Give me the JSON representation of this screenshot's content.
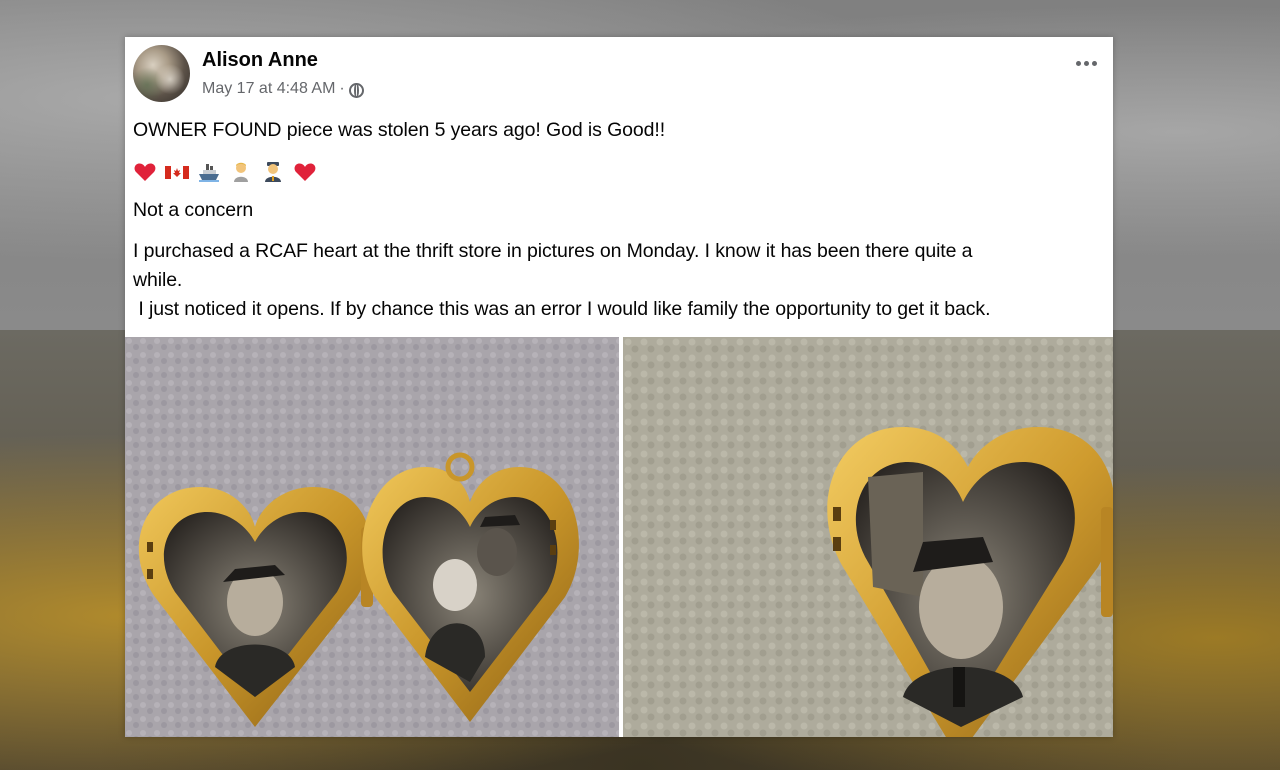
{
  "post": {
    "author": "Alison Anne",
    "timestamp": "May 17 at 4:48 AM",
    "separator": "·",
    "privacy_icon": "globe-icon",
    "more_icon": "more-options-icon",
    "headline": "OWNER FOUND piece was stolen 5 years ago! God is Good!!",
    "emojis": [
      "red-heart",
      "canada-flag",
      "ship",
      "person",
      "person-uniform",
      "red-heart"
    ],
    "line2": "Not a concern",
    "paragraph_lines": [
      "I purchased a RCAF heart at the thrift store in pictures on Monday. I know it has been there quite a",
      "while.",
      " I just noticed it opens. If by chance this was an error I would like family the opportunity to get it back."
    ]
  },
  "colors": {
    "card": "#ffffff",
    "text": "#050505",
    "meta": "#65676b",
    "gold": "#c9962a"
  }
}
